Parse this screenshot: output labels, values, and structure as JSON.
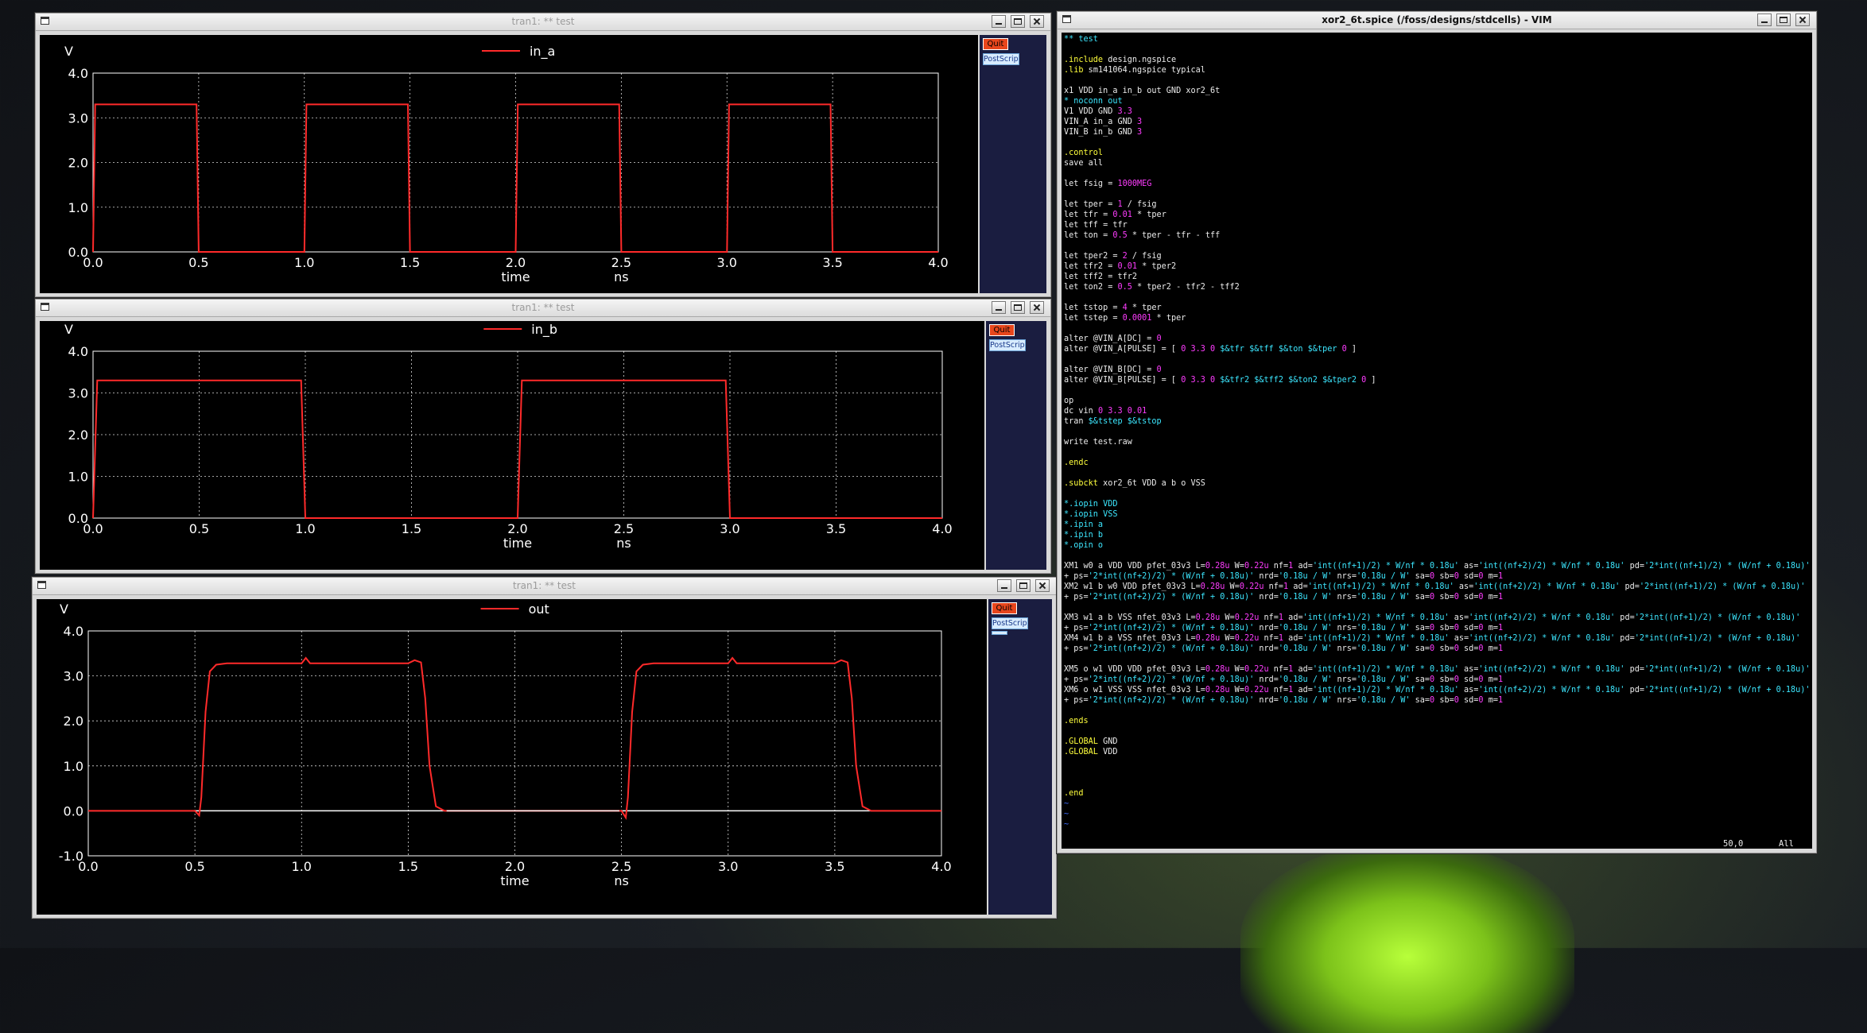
{
  "plot_a": {
    "title": "tran1: ** test",
    "quit_label": "Quit",
    "postscript_label": "PostScript",
    "chart_data": {
      "type": "line",
      "title": "",
      "legend": "in_a",
      "ylabel": "V",
      "xlabel": "time",
      "xunit": "ns",
      "xlim": [
        0.0,
        4.0
      ],
      "ylim": [
        0.0,
        4.0
      ],
      "xticks": [
        "0.0",
        "0.5",
        "1.0",
        "1.5",
        "2.0",
        "2.5",
        "3.0",
        "3.5",
        "4.0"
      ],
      "yticks": [
        "0.0",
        "1.0",
        "2.0",
        "3.0",
        "4.0"
      ],
      "grid": true,
      "series": [
        {
          "name": "in_a",
          "color": "#ff2a2a",
          "x": [
            0.0,
            0.01,
            0.02,
            0.49,
            0.5,
            1.0,
            1.01,
            1.49,
            1.5,
            2.0,
            2.01,
            2.49,
            2.5,
            3.0,
            3.01,
            3.49,
            3.5,
            4.0
          ],
          "y": [
            0.0,
            3.3,
            3.3,
            3.3,
            0.0,
            0.0,
            3.3,
            3.3,
            0.0,
            0.0,
            3.3,
            3.3,
            0.0,
            0.0,
            3.3,
            3.3,
            0.0,
            0.0
          ]
        }
      ]
    }
  },
  "plot_b": {
    "title": "tran1: ** test",
    "quit_label": "Quit",
    "postscript_label": "PostScript",
    "chart_data": {
      "type": "line",
      "title": "",
      "legend": "in_b",
      "ylabel": "V",
      "xlabel": "time",
      "xunit": "ns",
      "xlim": [
        0.0,
        4.0
      ],
      "ylim": [
        0.0,
        4.0
      ],
      "xticks": [
        "0.0",
        "0.5",
        "1.0",
        "1.5",
        "2.0",
        "2.5",
        "3.0",
        "3.5",
        "4.0"
      ],
      "yticks": [
        "0.0",
        "1.0",
        "2.0",
        "3.0",
        "4.0"
      ],
      "grid": true,
      "series": [
        {
          "name": "in_b",
          "color": "#ff2a2a",
          "x": [
            0.0,
            0.02,
            0.98,
            1.0,
            2.0,
            2.02,
            2.98,
            3.0,
            4.0
          ],
          "y": [
            0.0,
            3.3,
            3.3,
            0.0,
            0.0,
            3.3,
            3.3,
            0.0,
            0.0
          ]
        }
      ]
    }
  },
  "plot_out": {
    "title": "tran1: ** test",
    "quit_label": "Quit",
    "postscript_label": "PostScript",
    "chart_data": {
      "type": "line",
      "title": "",
      "legend": "out",
      "ylabel": "V",
      "xlabel": "time",
      "xunit": "ns",
      "xlim": [
        0.0,
        4.0
      ],
      "ylim": [
        -1.0,
        4.0
      ],
      "xticks": [
        "0.0",
        "0.5",
        "1.0",
        "1.5",
        "2.0",
        "2.5",
        "3.0",
        "3.5",
        "4.0"
      ],
      "yticks": [
        "-1.0",
        "0.0",
        "1.0",
        "2.0",
        "3.0",
        "4.0"
      ],
      "grid": true,
      "series": [
        {
          "name": "out",
          "color": "#ff2a2a",
          "x": [
            0.0,
            0.5,
            0.52,
            0.53,
            0.55,
            0.57,
            0.6,
            0.65,
            1.0,
            1.02,
            1.04,
            1.1,
            1.5,
            1.53,
            1.56,
            1.58,
            1.6,
            1.63,
            1.67,
            2.0,
            2.5,
            2.52,
            2.53,
            2.55,
            2.57,
            2.6,
            2.65,
            3.0,
            3.02,
            3.04,
            3.1,
            3.5,
            3.53,
            3.56,
            3.58,
            3.6,
            3.63,
            3.67,
            4.0
          ],
          "y": [
            0.0,
            0.0,
            -0.1,
            0.3,
            2.2,
            3.1,
            3.25,
            3.28,
            3.28,
            3.4,
            3.28,
            3.28,
            3.28,
            3.35,
            3.3,
            2.5,
            1.0,
            0.1,
            0.0,
            0.0,
            0.0,
            -0.15,
            0.3,
            2.2,
            3.1,
            3.25,
            3.28,
            3.28,
            3.4,
            3.28,
            3.28,
            3.28,
            3.35,
            3.3,
            2.5,
            1.0,
            0.1,
            0.0,
            0.0
          ]
        }
      ]
    }
  },
  "vim": {
    "title": "xor2_6t.spice (/foss/designs/stdcells) - VIM",
    "cursor_pos": "50,0",
    "scroll_pos": "All",
    "lines": [
      [
        [
          "** test",
          "c"
        ]
      ],
      [],
      [
        [
          ".include",
          "y"
        ],
        [
          " design.ngspice",
          "w"
        ]
      ],
      [
        [
          ".lib",
          "y"
        ],
        [
          " sm141064.ngspice typical",
          "w"
        ]
      ],
      [],
      [
        [
          "x1 VDD in_a in_b out GND xor2_6t",
          "w"
        ]
      ],
      [
        [
          "* noconn out",
          "c"
        ]
      ],
      [
        [
          "V1 VDD GND ",
          "w"
        ],
        [
          "3.3",
          "m"
        ]
      ],
      [
        [
          "VIN_A in_a GND ",
          "w"
        ],
        [
          "3",
          "m"
        ]
      ],
      [
        [
          "VIN_B in_b GND ",
          "w"
        ],
        [
          "3",
          "m"
        ]
      ],
      [],
      [
        [
          ".control",
          "y"
        ]
      ],
      [
        [
          "save all",
          "w"
        ]
      ],
      [],
      [
        [
          "let fsig = ",
          "w"
        ],
        [
          "1000MEG",
          "m"
        ]
      ],
      [],
      [
        [
          "let tper = ",
          "w"
        ],
        [
          "1",
          "m"
        ],
        [
          " / fsig",
          "w"
        ]
      ],
      [
        [
          "let tfr = ",
          "w"
        ],
        [
          "0.01",
          "m"
        ],
        [
          " * tper",
          "w"
        ]
      ],
      [
        [
          "let tff = tfr",
          "w"
        ]
      ],
      [
        [
          "let ton = ",
          "w"
        ],
        [
          "0.5",
          "m"
        ],
        [
          " * tper - tfr - tff",
          "w"
        ]
      ],
      [],
      [
        [
          "let tper2 = ",
          "w"
        ],
        [
          "2",
          "m"
        ],
        [
          " / fsig",
          "w"
        ]
      ],
      [
        [
          "let tfr2 = ",
          "w"
        ],
        [
          "0.01",
          "m"
        ],
        [
          " * tper2",
          "w"
        ]
      ],
      [
        [
          "let tff2 = tfr2",
          "w"
        ]
      ],
      [
        [
          "let ton2 = ",
          "w"
        ],
        [
          "0.5",
          "m"
        ],
        [
          " * tper2 - tfr2 - tff2",
          "w"
        ]
      ],
      [],
      [
        [
          "let tstop = ",
          "w"
        ],
        [
          "4",
          "m"
        ],
        [
          " * tper",
          "w"
        ]
      ],
      [
        [
          "let tstep = ",
          "w"
        ],
        [
          "0.0001",
          "m"
        ],
        [
          " * tper",
          "w"
        ]
      ],
      [],
      [
        [
          "alter @VIN_A[DC] = ",
          "w"
        ],
        [
          "0",
          "m"
        ]
      ],
      [
        [
          "alter @VIN_A[PULSE] = [ ",
          "w"
        ],
        [
          "0 3.3 0",
          "m"
        ],
        [
          " $&tfr $&tff $&ton $&tper ",
          "c"
        ],
        [
          "0",
          "m"
        ],
        [
          " ]",
          "w"
        ]
      ],
      [],
      [
        [
          "alter @VIN_B[DC] = ",
          "w"
        ],
        [
          "0",
          "m"
        ]
      ],
      [
        [
          "alter @VIN_B[PULSE] = [ ",
          "w"
        ],
        [
          "0 3.3 0",
          "m"
        ],
        [
          " $&tfr2 $&tff2 $&ton2 $&tper2 ",
          "c"
        ],
        [
          "0",
          "m"
        ],
        [
          " ]",
          "w"
        ]
      ],
      [],
      [
        [
          "op",
          "w"
        ]
      ],
      [
        [
          "dc vin ",
          "w"
        ],
        [
          "0 3.3 0.01",
          "m"
        ]
      ],
      [
        [
          "tran ",
          "w"
        ],
        [
          "$&tstep $&tstop",
          "c"
        ]
      ],
      [],
      [
        [
          "write test.raw",
          "w"
        ]
      ],
      [],
      [
        [
          ".endc",
          "y"
        ]
      ],
      [],
      [
        [
          ".subckt",
          "y"
        ],
        [
          " xor2_6t VDD a b o VSS",
          "w"
        ]
      ],
      [],
      [
        [
          "*.iopin VDD",
          "c"
        ]
      ],
      [
        [
          "*.iopin VSS",
          "c"
        ]
      ],
      [
        [
          "*.ipin a",
          "c"
        ]
      ],
      [
        [
          "*.ipin b",
          "c"
        ]
      ],
      [
        [
          "*.opin o",
          "c"
        ]
      ],
      [],
      [
        [
          "XM1 w0 a VDD VDD pfet_03v3 L=",
          "w"
        ],
        [
          "0.28u",
          "m"
        ],
        [
          " W=",
          "w"
        ],
        [
          "0.22u",
          "m"
        ],
        [
          " nf=",
          "w"
        ],
        [
          "1",
          "m"
        ],
        [
          " ad=",
          "w"
        ],
        [
          "'int((nf+1)/2) * W/nf * 0.18u'",
          "c"
        ],
        [
          " as=",
          "w"
        ],
        [
          "'int((nf+2)/2) * W/nf * 0.18u'",
          "c"
        ],
        [
          " pd=",
          "w"
        ],
        [
          "'2*int((nf+1)/2) * (W/nf + 0.18u)'",
          "c"
        ]
      ],
      [
        [
          "+ ps=",
          "w"
        ],
        [
          "'2*int((nf+2)/2) * (W/nf + 0.18u)'",
          "c"
        ],
        [
          " nrd=",
          "w"
        ],
        [
          "'0.18u / W'",
          "c"
        ],
        [
          " nrs=",
          "w"
        ],
        [
          "'0.18u / W'",
          "c"
        ],
        [
          " sa=",
          "w"
        ],
        [
          "0",
          "m"
        ],
        [
          " sb=",
          "w"
        ],
        [
          "0",
          "m"
        ],
        [
          " sd=",
          "w"
        ],
        [
          "0",
          "m"
        ],
        [
          " m=",
          "w"
        ],
        [
          "1",
          "m"
        ]
      ],
      [
        [
          "XM2 w1 b w0 VDD pfet_03v3 L=",
          "w"
        ],
        [
          "0.28u",
          "m"
        ],
        [
          " W=",
          "w"
        ],
        [
          "0.22u",
          "m"
        ],
        [
          " nf=",
          "w"
        ],
        [
          "1",
          "m"
        ],
        [
          " ad=",
          "w"
        ],
        [
          "'int((nf+1)/2) * W/nf * 0.18u'",
          "c"
        ],
        [
          " as=",
          "w"
        ],
        [
          "'int((nf+2)/2) * W/nf * 0.18u'",
          "c"
        ],
        [
          " pd=",
          "w"
        ],
        [
          "'2*int((nf+1)/2) * (W/nf + 0.18u)'",
          "c"
        ]
      ],
      [
        [
          "+ ps=",
          "w"
        ],
        [
          "'2*int((nf+2)/2) * (W/nf + 0.18u)'",
          "c"
        ],
        [
          " nrd=",
          "w"
        ],
        [
          "'0.18u / W'",
          "c"
        ],
        [
          " nrs=",
          "w"
        ],
        [
          "'0.18u / W'",
          "c"
        ],
        [
          " sa=",
          "w"
        ],
        [
          "0",
          "m"
        ],
        [
          " sb=",
          "w"
        ],
        [
          "0",
          "m"
        ],
        [
          " sd=",
          "w"
        ],
        [
          "0",
          "m"
        ],
        [
          " m=",
          "w"
        ],
        [
          "1",
          "m"
        ]
      ],
      [],
      [
        [
          "XM3 w1 a b VSS nfet_03v3 L=",
          "w"
        ],
        [
          "0.28u",
          "m"
        ],
        [
          " W=",
          "w"
        ],
        [
          "0.22u",
          "m"
        ],
        [
          " nf=",
          "w"
        ],
        [
          "1",
          "m"
        ],
        [
          " ad=",
          "w"
        ],
        [
          "'int((nf+1)/2) * W/nf * 0.18u'",
          "c"
        ],
        [
          " as=",
          "w"
        ],
        [
          "'int((nf+2)/2) * W/nf * 0.18u'",
          "c"
        ],
        [
          " pd=",
          "w"
        ],
        [
          "'2*int((nf+1)/2) * (W/nf + 0.18u)'",
          "c"
        ]
      ],
      [
        [
          "+ ps=",
          "w"
        ],
        [
          "'2*int((nf+2)/2) * (W/nf + 0.18u)'",
          "c"
        ],
        [
          " nrd=",
          "w"
        ],
        [
          "'0.18u / W'",
          "c"
        ],
        [
          " nrs=",
          "w"
        ],
        [
          "'0.18u / W'",
          "c"
        ],
        [
          " sa=",
          "w"
        ],
        [
          "0",
          "m"
        ],
        [
          " sb=",
          "w"
        ],
        [
          "0",
          "m"
        ],
        [
          " sd=",
          "w"
        ],
        [
          "0",
          "m"
        ],
        [
          " m=",
          "w"
        ],
        [
          "1",
          "m"
        ]
      ],
      [
        [
          "XM4 w1 b a VSS nfet_03v3 L=",
          "w"
        ],
        [
          "0.28u",
          "m"
        ],
        [
          " W=",
          "w"
        ],
        [
          "0.22u",
          "m"
        ],
        [
          " nf=",
          "w"
        ],
        [
          "1",
          "m"
        ],
        [
          " ad=",
          "w"
        ],
        [
          "'int((nf+1)/2) * W/nf * 0.18u'",
          "c"
        ],
        [
          " as=",
          "w"
        ],
        [
          "'int((nf+2)/2) * W/nf * 0.18u'",
          "c"
        ],
        [
          " pd=",
          "w"
        ],
        [
          "'2*int((nf+1)/2) * (W/nf + 0.18u)'",
          "c"
        ]
      ],
      [
        [
          "+ ps=",
          "w"
        ],
        [
          "'2*int((nf+2)/2) * (W/nf + 0.18u)'",
          "c"
        ],
        [
          " nrd=",
          "w"
        ],
        [
          "'0.18u / W'",
          "c"
        ],
        [
          " nrs=",
          "w"
        ],
        [
          "'0.18u / W'",
          "c"
        ],
        [
          " sa=",
          "w"
        ],
        [
          "0",
          "m"
        ],
        [
          " sb=",
          "w"
        ],
        [
          "0",
          "m"
        ],
        [
          " sd=",
          "w"
        ],
        [
          "0",
          "m"
        ],
        [
          " m=",
          "w"
        ],
        [
          "1",
          "m"
        ]
      ],
      [],
      [
        [
          "XM5 o w1 VDD VDD pfet_03v3 L=",
          "w"
        ],
        [
          "0.28u",
          "m"
        ],
        [
          " W=",
          "w"
        ],
        [
          "0.22u",
          "m"
        ],
        [
          " nf=",
          "w"
        ],
        [
          "1",
          "m"
        ],
        [
          " ad=",
          "w"
        ],
        [
          "'int((nf+1)/2) * W/nf * 0.18u'",
          "c"
        ],
        [
          " as=",
          "w"
        ],
        [
          "'int((nf+2)/2) * W/nf * 0.18u'",
          "c"
        ],
        [
          " pd=",
          "w"
        ],
        [
          "'2*int((nf+1)/2) * (W/nf + 0.18u)'",
          "c"
        ]
      ],
      [
        [
          "+ ps=",
          "w"
        ],
        [
          "'2*int((nf+2)/2) * (W/nf + 0.18u)'",
          "c"
        ],
        [
          " nrd=",
          "w"
        ],
        [
          "'0.18u / W'",
          "c"
        ],
        [
          " nrs=",
          "w"
        ],
        [
          "'0.18u / W'",
          "c"
        ],
        [
          " sa=",
          "w"
        ],
        [
          "0",
          "m"
        ],
        [
          " sb=",
          "w"
        ],
        [
          "0",
          "m"
        ],
        [
          " sd=",
          "w"
        ],
        [
          "0",
          "m"
        ],
        [
          " m=",
          "w"
        ],
        [
          "1",
          "m"
        ]
      ],
      [
        [
          "XM6 o w1 VSS VSS nfet_03v3 L=",
          "w"
        ],
        [
          "0.28u",
          "m"
        ],
        [
          " W=",
          "w"
        ],
        [
          "0.22u",
          "m"
        ],
        [
          " nf=",
          "w"
        ],
        [
          "1",
          "m"
        ],
        [
          " ad=",
          "w"
        ],
        [
          "'int((nf+1)/2) * W/nf * 0.18u'",
          "c"
        ],
        [
          " as=",
          "w"
        ],
        [
          "'int((nf+2)/2) * W/nf * 0.18u'",
          "c"
        ],
        [
          " pd=",
          "w"
        ],
        [
          "'2*int((nf+1)/2) * (W/nf + 0.18u)'",
          "c"
        ]
      ],
      [
        [
          "+ ps=",
          "w"
        ],
        [
          "'2*int((nf+2)/2) * (W/nf + 0.18u)'",
          "c"
        ],
        [
          " nrd=",
          "w"
        ],
        [
          "'0.18u / W'",
          "c"
        ],
        [
          " nrs=",
          "w"
        ],
        [
          "'0.18u / W'",
          "c"
        ],
        [
          " sa=",
          "w"
        ],
        [
          "0",
          "m"
        ],
        [
          " sb=",
          "w"
        ],
        [
          "0",
          "m"
        ],
        [
          " sd=",
          "w"
        ],
        [
          "0",
          "m"
        ],
        [
          " m=",
          "w"
        ],
        [
          "1",
          "m"
        ]
      ],
      [],
      [
        [
          ".ends",
          "y"
        ]
      ],
      [],
      [
        [
          ".GLOBAL",
          "y"
        ],
        [
          " GND",
          "w"
        ]
      ],
      [
        [
          ".GLOBAL",
          "y"
        ],
        [
          " VDD",
          "w"
        ]
      ],
      [],
      [],
      [],
      [
        [
          ".end",
          "y"
        ]
      ],
      [
        [
          "~",
          "b"
        ]
      ],
      [
        [
          "~",
          "b"
        ]
      ],
      [
        [
          "~",
          "b"
        ]
      ]
    ]
  }
}
